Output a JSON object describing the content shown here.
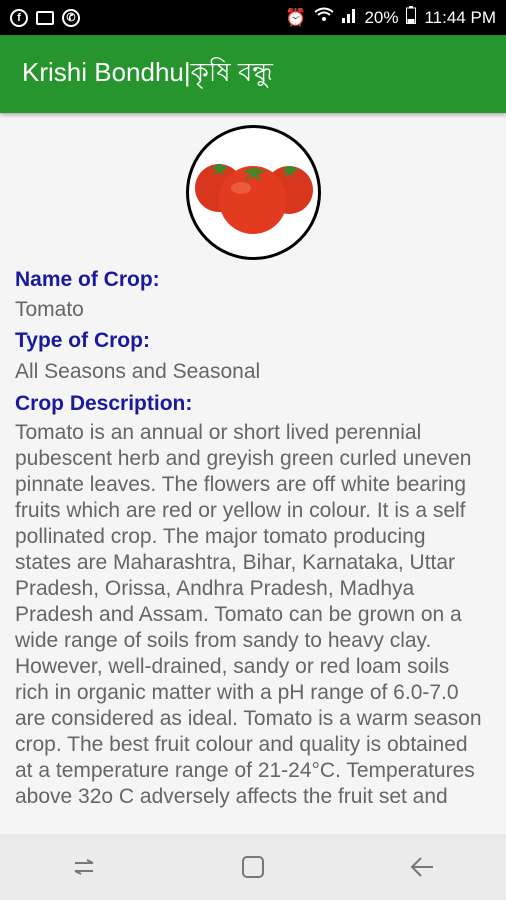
{
  "status": {
    "battery": "20%",
    "time": "11:44 PM"
  },
  "app": {
    "title": "Krishi Bondhu|কৃষি বন্ধু"
  },
  "crop": {
    "name_label": "Name of Crop:",
    "name": "Tomato",
    "type_label": "Type of Crop:",
    "type": "All Seasons and Seasonal",
    "desc_label": "Crop Description:",
    "description": "Tomato is an annual or short lived perennial pubescent herb and greyish green curled uneven pinnate leaves. The flowers are off white bearing fruits which are red or yellow in colour. It is a self pollinated crop. The major tomato producing states are Maharashtra, Bihar, Karnataka, Uttar Pradesh, Orissa, Andhra Pradesh, Madhya Pradesh and Assam. Tomato can be grown on a wide range of soils from sandy to heavy clay. However, well-drained, sandy or red loam soils rich in organic matter with a pH range of 6.0-7.0 are considered as ideal. Tomato is a warm season crop. The best fruit colour and quality is obtained at a temperature range of 21-24°C. Temperatures above 32o C adversely affects the fruit set and"
  },
  "icons": [
    "facebook-icon",
    "image-icon",
    "whatsapp-icon",
    "alarm-icon",
    "wifi-icon",
    "signal-icon",
    "battery-icon",
    "recent-apps-icon",
    "home-icon",
    "back-icon"
  ]
}
